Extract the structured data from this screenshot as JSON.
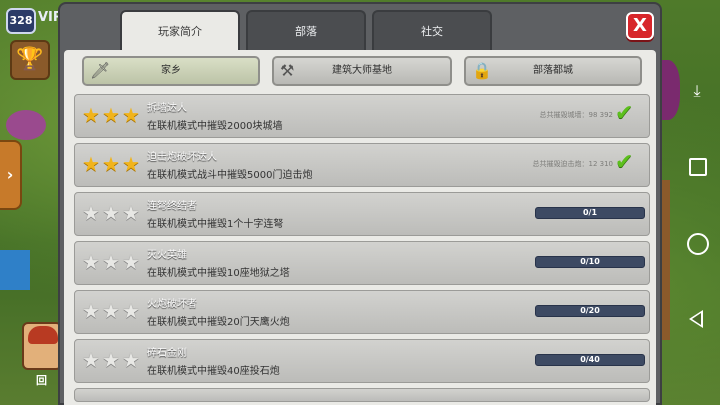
{
  "hud": {
    "trophy_count": "328",
    "vip_text": "VIP",
    "avatar_label": "回"
  },
  "tabs": [
    {
      "label": "玩家简介",
      "active": true
    },
    {
      "label": "部落",
      "active": false
    },
    {
      "label": "社交",
      "active": false
    }
  ],
  "close_label": "X",
  "categories": [
    {
      "label": "家乡",
      "icon": "sword-icon",
      "active": true
    },
    {
      "label": "建筑大师基地",
      "icon": "crossed-hammers-icon",
      "active": false
    },
    {
      "label": "部落都城",
      "icon": "lock-icon",
      "active": false
    }
  ],
  "achievements": [
    {
      "title": "拆墙达人",
      "desc": "在联机模式中摧毁2000块城墙",
      "stars": 3,
      "total": "总共摧毁城墙：98 392",
      "completed": true
    },
    {
      "title": "迫击炮破坏达人",
      "desc": "在联机模式战斗中摧毁5000门迫击炮",
      "stars": 3,
      "total": "总共摧毁迫击炮：12 310",
      "completed": true
    },
    {
      "title": "连弩终结者",
      "desc": "在联机模式中摧毁1个十字连弩",
      "stars": 0,
      "progress": "0/1",
      "progress_fraction": 0
    },
    {
      "title": "灭火英雄",
      "desc": "在联机模式中摧毁10座地狱之塔",
      "stars": 0,
      "progress": "0/10",
      "progress_fraction": 0
    },
    {
      "title": "火炮破坏者",
      "desc": "在联机模式中摧毁20门天鹰火炮",
      "stars": 0,
      "progress": "0/20",
      "progress_fraction": 0
    },
    {
      "title": "碎石金刚",
      "desc": "在联机模式中摧毁40座投石炮",
      "stars": 0,
      "progress": "0/40",
      "progress_fraction": 0
    }
  ],
  "colors": {
    "panel": "#5e6063",
    "content": "#eaeae6",
    "close_red": "#d7262b",
    "star_gold": "#f1b41c",
    "check_green": "#5cbf1d",
    "progress_bg": "#3d4a63"
  }
}
